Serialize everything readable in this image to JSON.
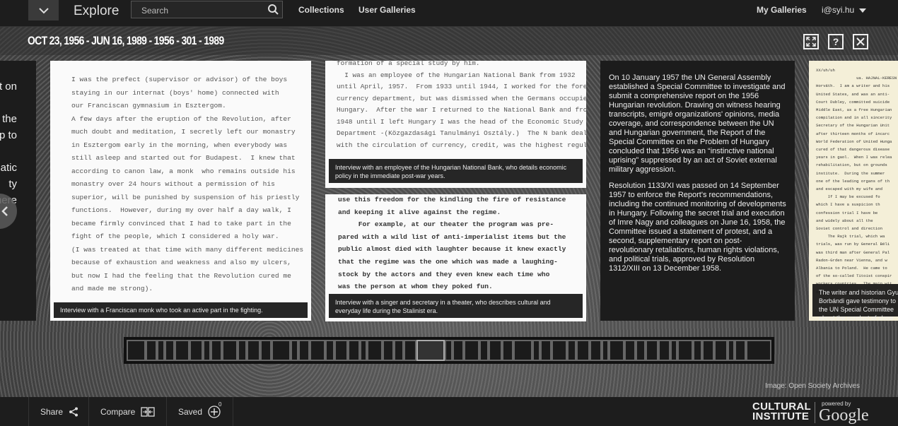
{
  "header": {
    "app_title": "Explore",
    "search_placeholder": "Search",
    "nav": [
      "Collections",
      "User Galleries"
    ],
    "my_galleries": "My Galleries",
    "user": "i@syi.hu"
  },
  "gallery": {
    "title": "OCT 23, 1956 - JUN 16, 1989 - 1956 - 301 - 1989",
    "help_label": "?",
    "left_partial_text": [
      "t on",
      "the",
      "up to",
      "atic",
      "ty",
      "here"
    ],
    "cards": [
      {
        "doc_lines": [
          "I was the prefect (supervisor or advisor) of the boys",
          "staying in our internat (boys' home) connected with",
          "our Franciscan gymnasium in Esztergom.",
          "A few days after the eruption of the Revolution, after",
          "much doubt and meditation, I secretly left our monastry",
          "in Esztergom early in the morning, when everybody was",
          "still asleep and started out for Budapest.  I knew that",
          "according to canon law, a monk  who remains outside his",
          "monastry over 24 hours without a permission of his",
          "superior, will be punished by suspension of his priestly",
          "functions.  However, during my over half a day walk, I",
          "became firmly convinced that I had to take part in the",
          "fight of the people, which I considered a holy war.",
          "(I was treated at that time with many different medicines",
          "because of exhaustion and weakness and also my ulcers,",
          "but now I had the feeling that the Revolution cured me",
          "and made me strong)."
        ],
        "caption": "Interview with a Franciscan monk who took an active part in the fighting."
      },
      {
        "doc_lines": [
          "formation of a special study by him.",
          "  I was an employee of the Hungarian National Bank from 1932",
          "until April, 1957.  From 1933 until 1944, I worked for the foreign",
          "currency department, but was dismissed when the Germans occupied",
          "Hungary.  After the war I returned to the National Bank and from",
          "1948 until I left Hungary I was the head of the Economic Study",
          "Department -(Közgazdasági Tanulmányi Osztály.)  The N bank dealt",
          "with the circulation of currency, credit, was the highest regula-"
        ],
        "caption": "Interview with an employee of the Hungarian National Bank, who details economic policy in the immediate post-war years."
      },
      {
        "doc_lines": [
          "use this freedom for the kindling the fire of resistance",
          "and keeping it alive against the regime.",
          "     For example, at our theater the program was pre-",
          "pared with a wild list of anti-imperialist items but the",
          "public almost died with laughter because it knew exactly",
          "that the regime was the one which was made a laughing-",
          "stock by the actors and they even knew each time who",
          "was the person at whom they poked fun."
        ],
        "caption": "Interview with a singer and secretary in a theater, who describes cultural and everyday life during the Stalinist era."
      },
      {
        "paragraphs": [
          "On 10 January 1957 the UN General Assembly established a Special Committee to investigate and submit a comprehensive report on the 1956 Hungarian revolution. Drawing on witness hearing transcripts, emigré organizations' opinions, media coverage, and correspondence between the UN and Hungarian government, the Report of the Special Committee on the Problem of Hungary concluded that 1956 was an “instinctive national uprising” suppressed by an act of Soviet external military aggression.",
          "Resolution 1133/XI was passed on 14 September 1957 to enforce the Report's recommendations, including the continued monitoring of developments in Hungary. Following the secret trial and execution of Imre Nagy and colleagues on June 16, 1958, the Committee issued a statement of protest, and a second, supplementary report on post-revolutionary retaliations, human rights violations, and political trials, approved by Resolution 1312/XIII on 13 December 1958."
        ]
      },
      {
        "doc_lines": [
          "XX/uh/uh",
          "",
          "                 ua. HAJNAL-KERESN (",
          "Horváth.  I am a writer and his",
          "United States, and was an anti-",
          "Court Dubley, committed suicide",
          "Middle East, as a free Hungarian",
          "compilation and in all sincerity",
          "Secretary of the Hungarian Unit",
          "after thirteen months of incarc",
          "World Federation of United Hunga",
          "cured of that dangerous disease",
          "years in gaol.  When I was relea",
          "rehabilitation, but on grounds",
          "institute.  During the summer ",
          "one of the leading organs of th",
          "and escaped with my wife and",
          "     If I may be excused fo",
          "which I have a suspicion th",
          "confession trial I have be",
          "and widely about all the",
          "Soviet control and direction",
          "     The Rajk trial, which wa",
          "trials, was run by General Béli",
          "was third man after General Pal",
          "Radon-Grden near Vienna, and w",
          "Albania to Poland.  He came to",
          "of the so-called Titoist conspir",
          "workers countries.  The main wit",
          "other cases were arrested party"
        ],
        "caption": "The writer and historian Gyula Borbándi gave testimony to the UN Special Committee about the conduct of show trials in Hungary."
      }
    ],
    "image_credit": "Image: Open Society Archives",
    "thumbnail_count": 52,
    "selected_thumbnail": 24
  },
  "footer": {
    "share": "Share",
    "compare": "Compare",
    "saved": "Saved",
    "saved_count": "0",
    "brand_line1": "CULTURAL",
    "brand_line2": "INSTITUTE",
    "powered_by": "powered by",
    "google": "Google"
  }
}
